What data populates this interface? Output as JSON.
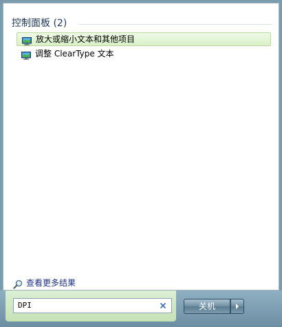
{
  "group": {
    "title": "控制面板 (2)"
  },
  "results": [
    {
      "label": "放大或缩小文本和其他项目",
      "icon": "control-panel-display-icon",
      "selected": true
    },
    {
      "label": "调整 ClearType 文本",
      "icon": "control-panel-display-icon",
      "selected": false
    }
  ],
  "more_results": {
    "label": "查看更多结果",
    "icon": "magnifier-icon"
  },
  "search": {
    "value": "DPI",
    "clear_icon": "clear-x-icon"
  },
  "shutdown": {
    "label": "关机",
    "arrow_icon": "triangle-right-icon"
  },
  "colors": {
    "selected_bg": "#d9f0c6",
    "group_title": "#1e395b",
    "link": "#1e3287",
    "bar": "#7a9cae"
  }
}
